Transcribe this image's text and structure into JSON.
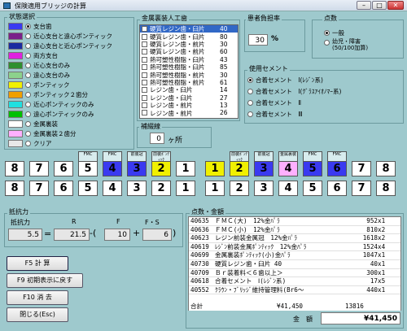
{
  "window": {
    "title": "保険適用ブリッジの計算",
    "minimize": "–",
    "maximize": "□",
    "close": "✕"
  },
  "status": {
    "title": "状態選択",
    "items": [
      {
        "label": "支台歯",
        "color": "#3a3af0",
        "selected": true
      },
      {
        "label": "近心支台と遠心ポンティック",
        "color": "#7a1f8a",
        "selected": false
      },
      {
        "label": "遠心支台と近心ポンティック",
        "color": "#1a2aa0",
        "selected": false
      },
      {
        "label": "両方支台",
        "color": "#e020e0",
        "selected": false
      },
      {
        "label": "近心支台のみ",
        "color": "#2f8f2f",
        "selected": false
      },
      {
        "label": "遠心支台のみ",
        "color": "#8cd28c",
        "selected": false
      },
      {
        "label": "ポンティック",
        "color": "#f0f000",
        "selected": false
      },
      {
        "label": "ポンティック２歯分",
        "color": "#f0a000",
        "selected": false
      },
      {
        "label": "近心ポンティックのみ",
        "color": "#20e0e0",
        "selected": false
      },
      {
        "label": "遠心ポンティックのみ",
        "color": "#00c000",
        "selected": false
      },
      {
        "label": "金属裏装",
        "color": "#ffffff",
        "selected": false
      },
      {
        "label": "金属裏装２歯分",
        "color": "#ffb0ff",
        "selected": false
      },
      {
        "label": "クリア",
        "color": "#e8e8e8",
        "selected": false
      }
    ]
  },
  "metal": {
    "title": "金属裏装人工歯",
    "items": [
      {
        "label": "硬質レジン歯・臼片",
        "value": "40",
        "selected": true
      },
      {
        "label": "硬質レジン歯・臼片",
        "value": "80",
        "selected": false
      },
      {
        "label": "硬質レジン歯・前片",
        "value": "30",
        "selected": false
      },
      {
        "label": "硬質レジン歯・前片",
        "value": "60",
        "selected": false
      },
      {
        "label": "熱可塑性樹脂・臼片",
        "value": "43",
        "selected": false
      },
      {
        "label": "熱可塑性樹脂・臼片",
        "value": "85",
        "selected": false
      },
      {
        "label": "熱可塑性樹脂・前片",
        "value": "30",
        "selected": false
      },
      {
        "label": "熱可塑性樹脂・前片",
        "value": "61",
        "selected": false
      },
      {
        "label": "レジン歯・臼片",
        "value": "14",
        "selected": false
      },
      {
        "label": "レジン歯・臼片",
        "value": "27",
        "selected": false
      },
      {
        "label": "レジン歯・前片",
        "value": "13",
        "selected": false
      },
      {
        "label": "レジン歯・前片",
        "value": "26",
        "selected": false
      }
    ]
  },
  "reinforce": {
    "title": "補綴線",
    "value": "0",
    "unit": "ヶ所"
  },
  "ratio": {
    "title": "患者負担率",
    "value": "30",
    "unit": "%"
  },
  "points": {
    "title": "点数",
    "items": [
      {
        "label": "一般",
        "selected": true
      },
      {
        "label": "幼児・障害\n(50/100加算)",
        "selected": false
      }
    ]
  },
  "cement": {
    "title": "使用セメント",
    "items": [
      {
        "label": "合着セメント　Ⅰ(ﾚｼﾞﾝ系)",
        "selected": true
      },
      {
        "label": "合着セメント　Ⅰ(ｸﾞﾗｽｱｲｵﾉﾏｰ系)",
        "selected": false
      },
      {
        "label": "合着セメント　Ⅱ",
        "selected": false
      },
      {
        "label": "合着セメント　Ⅲ",
        "selected": false
      }
    ]
  },
  "teeth": {
    "upper_labels": [
      "",
      "",
      "",
      "FMC",
      "FMC",
      "前装冠",
      "前装ﾎﾟﾝﾃｨｯｸ",
      "",
      "",
      "前装ﾎﾟﾝﾃｨｯｸ",
      "前装冠",
      "金属裏装",
      "FMC",
      "FMC",
      "",
      ""
    ],
    "upper": [
      "8",
      "7",
      "6",
      "5",
      "4",
      "3",
      "2",
      "1",
      "1",
      "2",
      "3",
      "4",
      "5",
      "6",
      "7",
      "8"
    ],
    "upper_colors": [
      "#ffffff",
      "#ffffff",
      "#ffffff",
      "#ffffff",
      "#3a3af0",
      "#3a3af0",
      "#f0f000",
      "#ffffff",
      "#f0f000",
      "#f0f000",
      "#3a3af0",
      "#ffb0ff",
      "#3a3af0",
      "#3a3af0",
      "#ffffff",
      "#ffffff"
    ],
    "lower": [
      "8",
      "7",
      "6",
      "5",
      "4",
      "3",
      "2",
      "1",
      "1",
      "2",
      "3",
      "4",
      "5",
      "6",
      "7",
      "8"
    ]
  },
  "resist": {
    "title": "抵抗力",
    "sub": "抵抗力",
    "h_r": "R",
    "h_f": "F",
    "h_fs": "F・S",
    "value": "5.5",
    "eq": "=",
    "r": "21.5",
    "minus": "-(",
    "f": "10",
    "plus": "+",
    "fs": "6",
    "close": ")"
  },
  "buttons": {
    "calc": "F5 計 算",
    "back": "F9 初期表示に戻す",
    "clear": "F10 消 去",
    "quit": "閉じる(Esc)"
  },
  "score": {
    "title": "点数・金額",
    "rows": [
      {
        "code": "40635",
        "name": "ＦＭＣ(大)　12%金ﾊﾟﾗ",
        "pts": "952",
        "mul": "1"
      },
      {
        "code": "40636",
        "name": "ＦＭＣ(小)　12%金ﾊﾟﾗ",
        "pts": "810",
        "mul": "2"
      },
      {
        "code": "40623",
        "name": "レジン前装金属冠　12%金ﾊﾟﾗ",
        "pts": "1618",
        "mul": "2"
      },
      {
        "code": "40619",
        "name": "ﾚｼﾞﾝ前装金属ﾎﾟﾝﾃｨｯｸ　12%金ﾊﾟﾗ",
        "pts": "1524",
        "mul": "4"
      },
      {
        "code": "40699",
        "name": "金属裏装ﾎﾟﾝﾃｨｯｸ(小)金ﾊﾟﾗ",
        "pts": "1047",
        "mul": "1"
      },
      {
        "code": "40730",
        "name": "硬質レジン歯・臼片 40",
        "pts": "40",
        "mul": "1"
      },
      {
        "code": "40709",
        "name": "Ｂｒ装着料＜６歯以上＞",
        "pts": "300",
        "mul": "1"
      },
      {
        "code": "40618",
        "name": "合着セメント　Ⅰ(ﾚｼﾞﾝ系)",
        "pts": "17",
        "mul": "5"
      },
      {
        "code": "40552",
        "name": "ｸﾗｳﾝ・ﾌﾞﾘｯｼﾞ維持管理料(Br6～",
        "pts": "440",
        "mul": "1"
      }
    ],
    "total_label": "合計",
    "total_yen": "¥41,450",
    "total_pts": "13816",
    "amount_label": "金　額",
    "amount": "¥41,450"
  }
}
